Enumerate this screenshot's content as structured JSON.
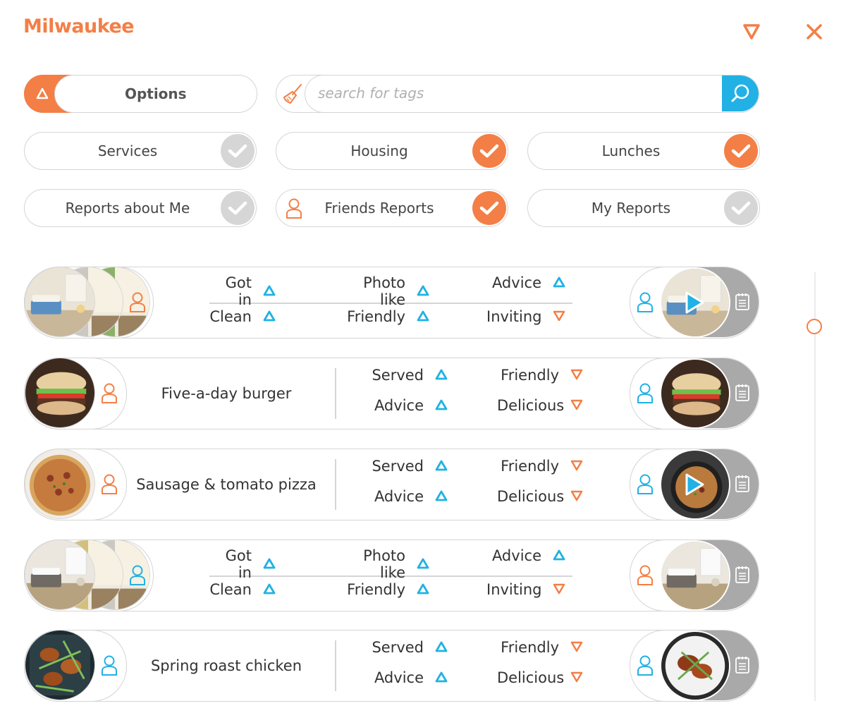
{
  "header": {
    "title": "Milwaukee",
    "filter_icon": "filter-triangle-icon",
    "close_icon": "close-icon",
    "accent_color": "#f37f46",
    "secondary_color": "#21b1e4"
  },
  "toolbar": {
    "options_label": "Options",
    "search_placeholder": "search for tags"
  },
  "filters": [
    {
      "label": "Services",
      "checked": false
    },
    {
      "label": "Housing",
      "checked": true
    },
    {
      "label": "Lunches",
      "checked": true
    },
    {
      "label": "Reports about Me",
      "checked": false
    },
    {
      "label": "Friends Reports",
      "checked": true
    },
    {
      "label": "My Reports",
      "checked": false
    }
  ],
  "reports": [
    {
      "kind": "housing",
      "tags": [
        {
          "label": "Got in",
          "dir": "up"
        },
        {
          "label": "Photo like",
          "dir": "up"
        },
        {
          "label": "Advice",
          "dir": "up"
        },
        {
          "label": "Clean",
          "dir": "up"
        },
        {
          "label": "Friendly",
          "dir": "up"
        },
        {
          "label": "Inviting",
          "dir": "down"
        }
      ],
      "has_video": true
    },
    {
      "kind": "lunch",
      "title": "Five-a-day burger",
      "tags": [
        {
          "label": "Served",
          "dir": "up"
        },
        {
          "label": "Friendly",
          "dir": "down"
        },
        {
          "label": "Advice",
          "dir": "up"
        },
        {
          "label": "Delicious",
          "dir": "down"
        }
      ],
      "has_video": false
    },
    {
      "kind": "lunch",
      "title": "Sausage & tomato pizza",
      "tags": [
        {
          "label": "Served",
          "dir": "up"
        },
        {
          "label": "Friendly",
          "dir": "down"
        },
        {
          "label": "Advice",
          "dir": "up"
        },
        {
          "label": "Delicious",
          "dir": "down"
        }
      ],
      "has_video": true
    },
    {
      "kind": "housing",
      "tags": [
        {
          "label": "Got in",
          "dir": "up"
        },
        {
          "label": "Photo like",
          "dir": "up"
        },
        {
          "label": "Advice",
          "dir": "up"
        },
        {
          "label": "Clean",
          "dir": "up"
        },
        {
          "label": "Friendly",
          "dir": "up"
        },
        {
          "label": "Inviting",
          "dir": "down"
        }
      ],
      "has_video": false
    },
    {
      "kind": "lunch",
      "title": "Spring roast chicken",
      "tags": [
        {
          "label": "Served",
          "dir": "up"
        },
        {
          "label": "Friendly",
          "dir": "down"
        },
        {
          "label": "Advice",
          "dir": "up"
        },
        {
          "label": "Delicious",
          "dir": "down"
        }
      ],
      "has_video": false
    }
  ]
}
